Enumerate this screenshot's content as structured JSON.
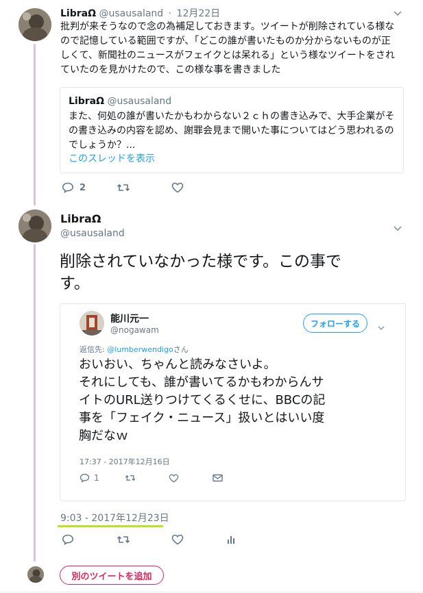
{
  "tweet1": {
    "name": "LibraΩ",
    "handle": "@usausaland",
    "separator": "·",
    "date": "12月22日",
    "lines": [
      "批判が来そうなので念の為補足しておきます。ツイートが削除されている様な",
      "ので記憶している範囲ですが、「どこの誰が書いたものか分からないものが正",
      "しくて、新聞社のニュースがフェイクとは呆れる」という様なツイートをされ",
      "ていたのを見かけたので、この様な事を書きました"
    ],
    "quote": {
      "name": "LibraΩ",
      "handle": "@usausaland",
      "lines": [
        "また、何処の誰が書いたかもわからない２ｃｈの書き込みで、大手企業がそ",
        "の書き込みの内容を認め、謝罪会見まで開いた事についてはどう思われるの",
        "でしょうか？..."
      ],
      "show_thread": "このスレッドを表示"
    },
    "reply_count": "2",
    "retweet_count": "",
    "like_count": ""
  },
  "tweet2": {
    "name": "LibraΩ",
    "handle": "@usausaland",
    "lines": [
      "削除されていなかった様です。この事で",
      "す。"
    ],
    "embed": {
      "name": "能川元一",
      "handle": "@nogawam",
      "follow_label": "フォローする",
      "reply_to_prefix": "返信先: ",
      "reply_to_handle": "@lumberwendigo",
      "reply_to_suffix": "さん",
      "lines": [
        "おいおい、ちゃんと読みなさいよ。",
        "それにしても、誰が書いてるかもわからんサ",
        "イトのURL送りつけてくるくせに、BBCの記",
        "事を「フェイク・ニュース」扱いとはいい度",
        "胸だなｗ"
      ],
      "timestamp": "17:37 - 2017年12月16日",
      "reply_count": "1"
    },
    "timestamp": "9:03 - 2017年12月23日",
    "highlight_color": "#b5e61d"
  },
  "compose": {
    "add_tweet_label": "別のツイートを追加"
  },
  "colors": {
    "thread_line": "#e2bfdc",
    "accent_blue": "#1da1f2",
    "add_tweet_pink": "#e0245e",
    "secondary_text": "#657786"
  }
}
